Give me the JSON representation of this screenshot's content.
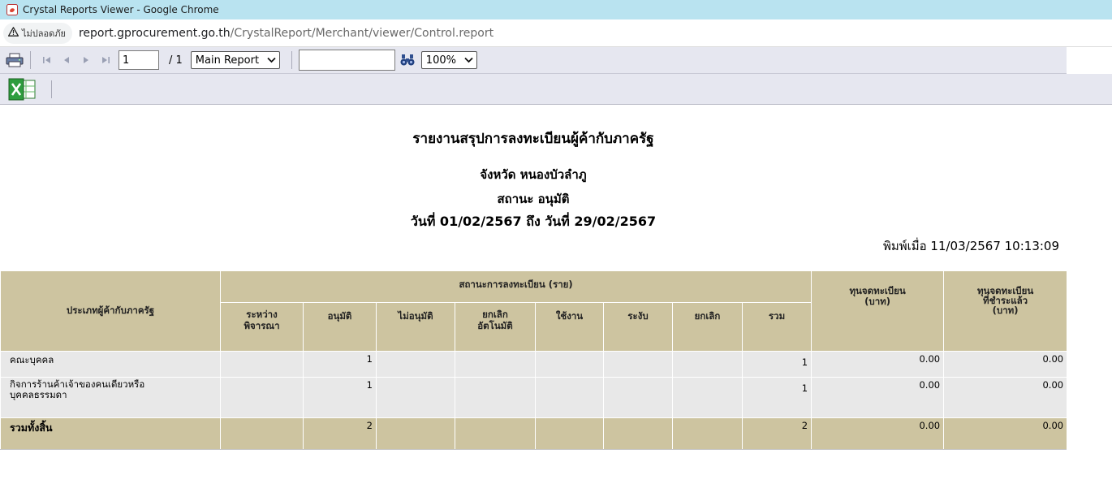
{
  "window": {
    "title": "Crystal Reports Viewer - Google Chrome"
  },
  "address_bar": {
    "security_label": "ไม่ปลอดภัย",
    "url_host": "report.gprocurement.go.th",
    "url_path": "/CrystalReport/Merchant/viewer/Control.report"
  },
  "toolbar": {
    "page_current": "1",
    "page_total": "/ 1",
    "report_select": "Main Report",
    "search_value": "",
    "zoom_select": "100%"
  },
  "report": {
    "title": "รายงานสรุปการลงทะเบียนผู้ค้ากับภาครัฐ",
    "province": "จังหวัด หนองบัวลำภู",
    "status": "สถานะ อนุมัติ",
    "date_range": "วันที่ 01/02/2567 ถึง วันที่ 29/02/2567",
    "printed_at": "พิมพ์เมื่อ 11/03/2567  10:13:09"
  },
  "table": {
    "header_type": "ประเภทผู้ค้ากับภาครัฐ",
    "header_status_group": "สถานะการลงทะเบียน (ราย)",
    "header_capital": "ทุนจดทะเบียน\n(บาท)",
    "header_paid_capital": "ทุนจดทะเบียน\nที่ชำระแล้ว\n(บาท)",
    "sub_headers": [
      "ระหว่าง\nพิจารณา",
      "อนุมัติ",
      "ไม่อนุมัติ",
      "ยกเลิก\nอัตโนมัติ",
      "ใช้งาน",
      "ระงับ",
      "ยกเลิก",
      "รวม"
    ],
    "rows": [
      {
        "type": "คณะบุคคล",
        "cells": [
          "",
          "1",
          "",
          "",
          "",
          "",
          "",
          "1"
        ],
        "capital": "0.00",
        "paid_capital": "0.00"
      },
      {
        "type": "กิจการร้านค้าเจ้าของคนเดียวหรือ\nบุคคลธรรมดา",
        "cells": [
          "",
          "1",
          "",
          "",
          "",
          "",
          "",
          "1"
        ],
        "capital": "0.00",
        "paid_capital": "0.00"
      }
    ],
    "total": {
      "label": "รวมทั้งสิ้น",
      "cells": [
        "",
        "2",
        "",
        "",
        "",
        "",
        "",
        "2"
      ],
      "capital": "0.00",
      "paid_capital": "0.00"
    }
  },
  "icons": {
    "app": "crystal-reports-icon",
    "security": "warning-icon",
    "print": "print-icon",
    "first": "first-page-icon",
    "prev": "prev-page-icon",
    "next": "next-page-icon",
    "last": "last-page-icon",
    "search": "binoculars-icon",
    "export": "excel-export-icon"
  },
  "colors": {
    "titlebar": "#b9e3f0",
    "toolbar": "#e6e7f0",
    "header_fill": "#cdc4a0",
    "row_fill": "#e8e8e8"
  }
}
